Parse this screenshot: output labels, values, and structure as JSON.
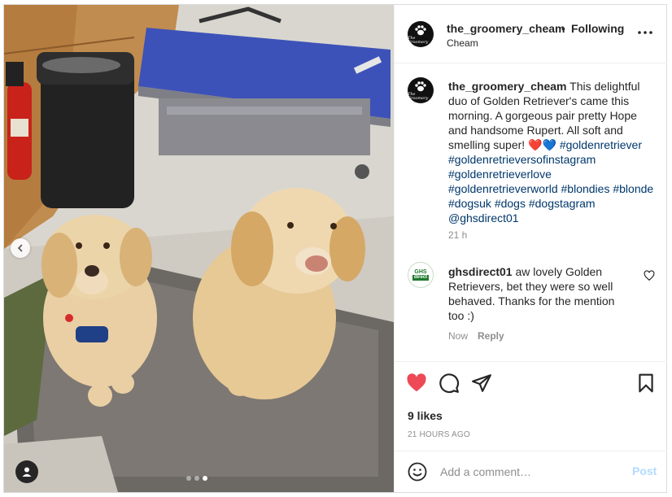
{
  "post": {
    "account": "the_groomery_cheam",
    "avatar_brand": "The Groomery",
    "separator": "•",
    "follow_status": "Following",
    "location": "Cheam",
    "more_icon": "more-horizontal-icon"
  },
  "caption": {
    "username": "the_groomery_cheam",
    "text": "This delightful duo of Golden Retriever's came this morning. A gorgeous pair pretty Hope and handsome Rupert. All soft and smelling super! ",
    "emojis": "❤️💙",
    "hashtags": "#goldenretriever #goldenretrieversofinstagram #goldenretrieverlove #goldenretrieverworld #blondies #blonde #dogsuk #dogs #dogstagram @ghsdirect01",
    "time": "21 h"
  },
  "comment": {
    "username": "ghsdirect01",
    "avatar_line1": "GHS",
    "avatar_line2": "direct",
    "text": "aw lovely Golden Retrievers, bet they were so well behaved. Thanks for the mention too :)",
    "time": "Now",
    "reply_label": "Reply"
  },
  "actions": {
    "liked": true,
    "like_color": "#ed4956",
    "likes": "9 likes",
    "posted_ago": "21 HOURS AGO"
  },
  "add_comment": {
    "placeholder": "Add a comment…",
    "post_label": "Post"
  },
  "carousel": {
    "slide_count": 3,
    "active_slide": 3
  }
}
